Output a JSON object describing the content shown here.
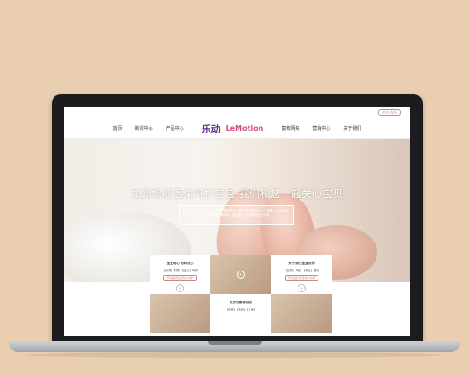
{
  "top_tag": "关注·在线",
  "nav": {
    "left": [
      "首页",
      "新闻中心",
      "产品中心"
    ],
    "right": [
      "富敏网络",
      "营销中心",
      "关于我们"
    ],
    "logo_cn": "乐动",
    "logo_en": "LeMotion"
  },
  "hero": {
    "title": "如妈妈般温柔呵护宝宝·我们和您一起关心宝贝",
    "box_text": "乐敏为人父母的您，为了宝宝健康成长，我们用心呵护每一个宝宝，100%纯天然材质，贴心呵护宝宝娇嫩肌肤，给宝宝一个温暖而安全的家"
  },
  "cards": [
    {
      "title": "宝宝用心 用料安心",
      "text": "【天然】材质 【贴心】呵护",
      "btn": "乐动品牌宝宝用心呵护",
      "style": "white"
    },
    {
      "title": "",
      "text": "",
      "btn": "",
      "style": "photo"
    },
    {
      "title": "关于我们宝宝世界",
      "text": "【优质】产品 【专业】服务",
      "btn": "乐动品牌宝宝用心呵护",
      "style": "white"
    },
    {
      "title": "",
      "text": "",
      "btn": "",
      "style": "photo"
    },
    {
      "title": "更多优惠请点击",
      "text": "【优惠】【活动】【礼品】",
      "btn": "",
      "style": "white"
    },
    {
      "title": "",
      "text": "",
      "btn": "",
      "style": "photo"
    }
  ],
  "dots_count": 4,
  "active_dot": 1
}
